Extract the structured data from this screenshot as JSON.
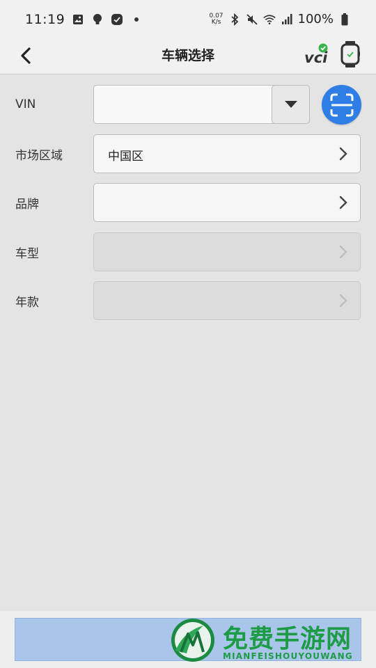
{
  "status_bar": {
    "time": "11:19",
    "net_speed_value": "0.07",
    "net_speed_unit": "K/s",
    "battery": "100%",
    "icons": [
      "gallery-icon",
      "bulb-icon",
      "app-icon",
      "dot-icon",
      "bluetooth-icon",
      "mute-icon",
      "wifi-icon",
      "signal-icon",
      "battery-icon"
    ]
  },
  "header": {
    "title": "车辆选择",
    "badge_text": "vci",
    "badge_status_color": "#3cb44a",
    "icons": [
      "back-icon",
      "watch-icon"
    ]
  },
  "form": {
    "vin": {
      "label": "VIN",
      "value": "",
      "placeholder": ""
    },
    "market": {
      "label": "市场区域",
      "value": "中国区"
    },
    "brand": {
      "label": "品牌",
      "value": ""
    },
    "model": {
      "label": "车型",
      "value": ""
    },
    "year": {
      "label": "年款",
      "value": ""
    }
  },
  "colors": {
    "accent": "#2f7ee6",
    "bottom_button": "#a9c5ea",
    "watermark": "#1d9b46"
  },
  "watermark": {
    "title": "免费手游网",
    "subtitle": "MIANFEISHOUYOUWANG"
  }
}
